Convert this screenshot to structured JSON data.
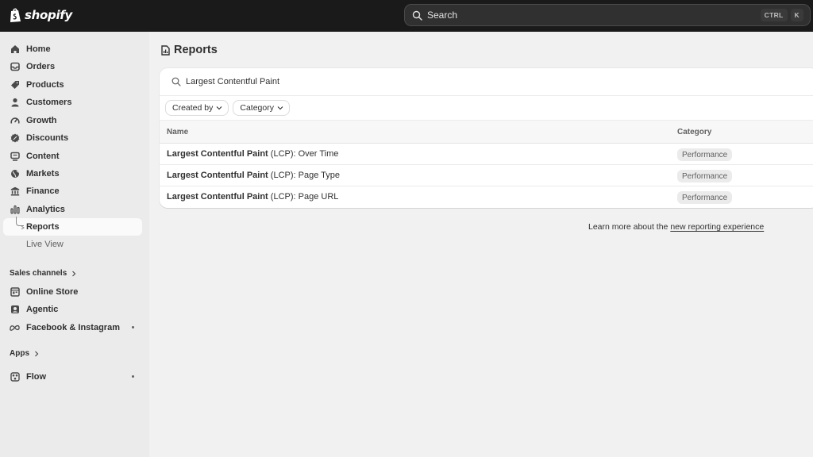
{
  "topbar": {
    "brand": "shopify",
    "search_label": "Search",
    "shortcut": [
      "CTRL",
      "K"
    ]
  },
  "sidebar": {
    "items": [
      {
        "label": "Home",
        "icon": "home-icon"
      },
      {
        "label": "Orders",
        "icon": "inbox-icon"
      },
      {
        "label": "Products",
        "icon": "tag-icon"
      },
      {
        "label": "Customers",
        "icon": "person-icon"
      },
      {
        "label": "Growth",
        "icon": "gauge-icon"
      },
      {
        "label": "Discounts",
        "icon": "discount-icon"
      },
      {
        "label": "Content",
        "icon": "content-icon"
      },
      {
        "label": "Markets",
        "icon": "globe-icon"
      },
      {
        "label": "Finance",
        "icon": "bank-icon"
      },
      {
        "label": "Analytics",
        "icon": "bar-chart-icon"
      }
    ],
    "sub_items": [
      {
        "label": "Reports",
        "active": true
      },
      {
        "label": "Live View",
        "active": false
      }
    ],
    "sales_channels_label": "Sales channels",
    "channels": [
      {
        "label": "Online Store",
        "icon": "store-icon"
      },
      {
        "label": "Agentic",
        "icon": "agentic-icon"
      },
      {
        "label": "Facebook & Instagram",
        "icon": "meta-icon"
      }
    ],
    "apps_label": "Apps",
    "apps": [
      {
        "label": "Flow",
        "icon": "flow-icon"
      }
    ]
  },
  "main": {
    "title": "Reports",
    "search_value": "Largest Contentful Paint",
    "filters": [
      "Created by",
      "Category"
    ],
    "columns": {
      "name": "Name",
      "category": "Category"
    },
    "rows": [
      {
        "name_bold": "Largest Contentful Paint",
        "name_rest": " (LCP): Over Time",
        "category": "Performance"
      },
      {
        "name_bold": "Largest Contentful Paint",
        "name_rest": " (LCP): Page Type",
        "category": "Performance"
      },
      {
        "name_bold": "Largest Contentful Paint",
        "name_rest": " (LCP): Page URL",
        "category": "Performance"
      }
    ],
    "learn_more_text": "Learn more about the ",
    "learn_more_link": "new reporting experience"
  }
}
